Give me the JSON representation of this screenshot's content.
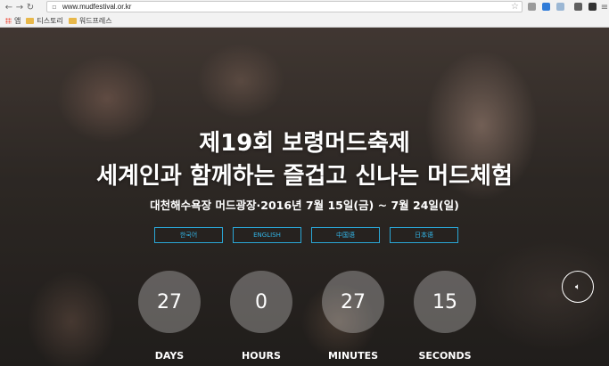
{
  "browser": {
    "url": "www.mudfestival.or.kr",
    "bookmarks": [
      "앱",
      "티스토리",
      "워드프레스"
    ]
  },
  "hero": {
    "title_line1": "제19회 보령머드축제",
    "title_line2": "세계인과 함께하는 즐겁고 신나는 머드체험",
    "subtitle": "대천해수욕장 머드광장·2016년 7월 15일(금) ~ 7월 24일(일)",
    "languages": [
      "한국어",
      "ENGLISH",
      "中国语",
      "日本语"
    ],
    "accent_color": "#2aa7d6"
  },
  "countdown": {
    "days": "27",
    "hours": "0",
    "minutes": "27",
    "seconds": "15",
    "labels": {
      "days": "DAYS",
      "hours": "HOURS",
      "minutes": "MINUTES",
      "seconds": "SECONDS"
    }
  },
  "icons": {
    "sound": "speaker-icon"
  }
}
